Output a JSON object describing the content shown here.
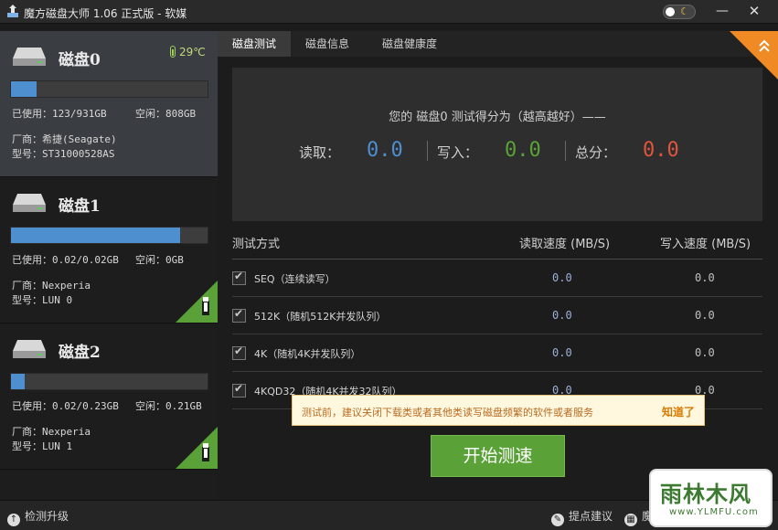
{
  "window": {
    "title": "魔方磁盘大师 1.06 正式版 - 软媒",
    "minimize_label": "—",
    "close_label": "✕"
  },
  "disks": [
    {
      "name": "磁盘0",
      "temperature": "29℃",
      "usage_fraction": 0.13,
      "used": "已使用：123/931GB",
      "free": "空闲：808GB",
      "vendor": "厂商：希捷(Seagate)",
      "model": "型号：ST31000528AS",
      "active": true,
      "usb": false
    },
    {
      "name": "磁盘1",
      "usage_fraction": 0.86,
      "used": "已使用：0.02/0.02GB",
      "free": "空闲：0GB",
      "vendor": "厂商：Nexperia",
      "model": "型号：LUN 0",
      "active": false,
      "usb": true
    },
    {
      "name": "磁盘2",
      "usage_fraction": 0.07,
      "used": "已使用：0.02/0.23GB",
      "free": "空闲：0.21GB",
      "vendor": "厂商：Nexperia",
      "model": "型号：LUN 1",
      "active": false,
      "usb": true
    }
  ],
  "tabs": [
    {
      "label": "磁盘测试",
      "active": true
    },
    {
      "label": "磁盘信息",
      "active": false
    },
    {
      "label": "磁盘健康度",
      "active": false
    }
  ],
  "score": {
    "title": "您的 磁盘0 测试得分为（越高越好）——",
    "read_label": "读取：",
    "read_value": "0.0",
    "write_label": "写入：",
    "write_value": "0.0",
    "total_label": "总分：",
    "total_value": "0.0"
  },
  "table": {
    "columns": [
      "测试方式",
      "读取速度 (MB/S)",
      "写入速度 (MB/S)"
    ],
    "rows": [
      {
        "label": "SEQ（连续读写）",
        "read": "0.0",
        "write": "0.0",
        "checked": true
      },
      {
        "label": "512K（随机512K并发队列）",
        "read": "0.0",
        "write": "0.0",
        "checked": true
      },
      {
        "label": "4K（随机4K并发队列）",
        "read": "0.0",
        "write": "0.0",
        "checked": true
      },
      {
        "label": "4KQD32（随机4K并发32队列）",
        "read": "0.0",
        "write": "0.0",
        "checked": true
      }
    ]
  },
  "tooltip": {
    "text": "测试前，建议关闭下载类或者其他类读写磁盘频繁的软件或者服务",
    "ack": "知道了"
  },
  "start_button": "开始测速",
  "statusbar": {
    "update": "检测升级",
    "feedback": "提点建议",
    "more": "魔"
  },
  "watermark": {
    "main": "雨林木风",
    "sub": "www.YLMFU.com"
  },
  "colors": {
    "read": "#4e8fcf",
    "write": "#5aa238",
    "total": "#e0553c",
    "accent": "#f08a24"
  }
}
